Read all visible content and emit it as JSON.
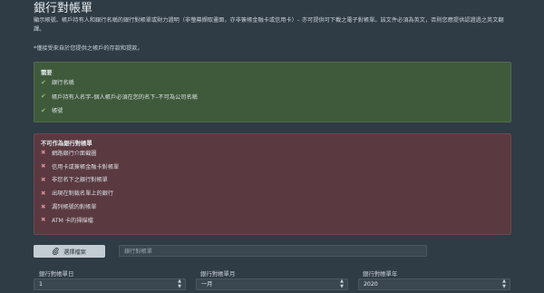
{
  "page": {
    "title": "銀行對帳單",
    "description": "顯示帳號、帳戶持有人和銀行名稱的銀行對帳單或財力證明（非螢幕擷取畫面，亦非簽帳金融卡或信用卡）– 亦可提供可下載之電子對帳單。該文件必須為英文，否則您應提供認證過之英文翻譯。",
    "note": "*僅接受來自於您提供之帳戶的存款和提款。"
  },
  "required": {
    "heading": "需要",
    "items": [
      "銀行名稱",
      "帳戶持有人名字–個人帳戶必須在您的名下–不可為公司名稱",
      "帳號"
    ]
  },
  "not_accepted": {
    "heading": "不可作為銀行對帳單",
    "items": [
      "網路銀行介面截圖",
      "信用卡或簽帳金融卡對帳單",
      "非您名下之銀行對帳單",
      "出現在制裁名單上的銀行",
      "漏列帳號的對帳單",
      "ATM 卡的掃描檔"
    ]
  },
  "upload": {
    "button_label": "選擇檔案",
    "field_value": "銀行對帳單"
  },
  "date_fields": {
    "day": {
      "label": "銀行對帳單日",
      "value": "1"
    },
    "month": {
      "label": "銀行對帳單月",
      "value": "一月"
    },
    "year": {
      "label": "銀行對帳單年",
      "value": "2020"
    }
  },
  "icons": {
    "check": "check-icon",
    "cross": "cross-icon",
    "paperclip": "paperclip-icon"
  },
  "colors": {
    "success_bg": "#3f5a3a",
    "danger_bg": "#5a3a40",
    "page_bg": "#2f3b45"
  }
}
